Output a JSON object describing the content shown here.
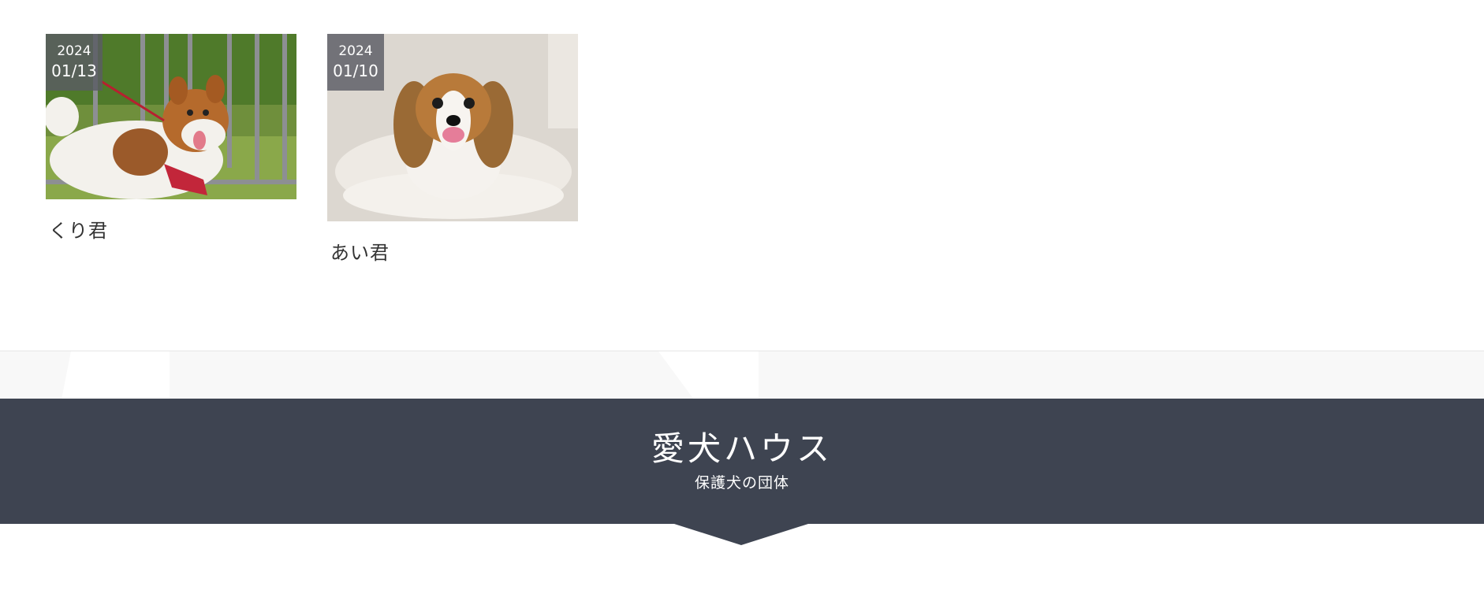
{
  "posts": [
    {
      "year": "2024",
      "month_day": "01/13",
      "title": "くり君",
      "image_icon": "dog-photo-icon"
    },
    {
      "year": "2024",
      "month_day": "01/10",
      "title": "あい君",
      "image_icon": "dog-photo-icon"
    }
  ],
  "footer": {
    "site_name": "愛犬ハウス",
    "tagline": "保護犬の団体"
  },
  "colors": {
    "footer_bg": "#3e4451",
    "badge_bg": "#5a5c64",
    "band_bg": "#f8f8f8"
  }
}
